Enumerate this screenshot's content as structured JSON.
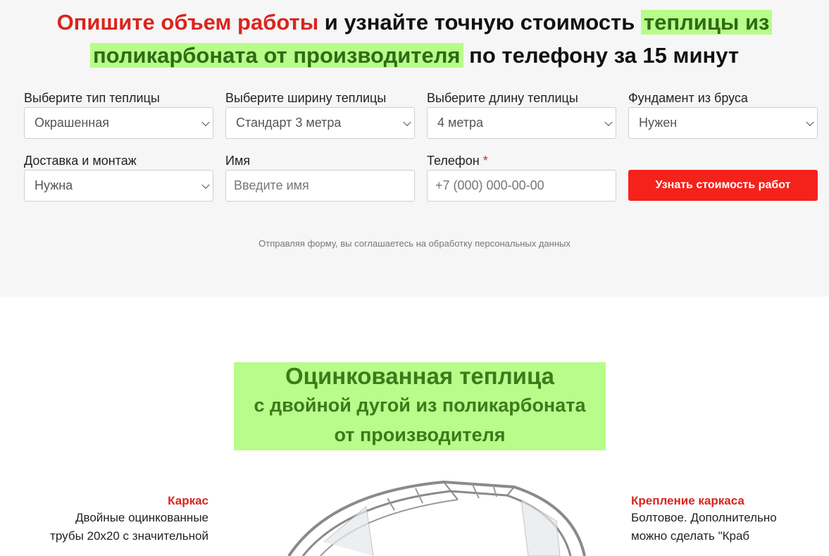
{
  "headline": {
    "part_red": "Опишите объем работы",
    "part_plain1": " и узнайте точную стоимость ",
    "part_green1": "теплицы из",
    "part_green2": "поликарбоната от производителя",
    "part_plain2": " по телефону за 15 минут"
  },
  "form": {
    "type": {
      "label": "Выберите тип теплицы",
      "value": "Окрашенная"
    },
    "width": {
      "label": "Выберите ширину теплицы",
      "value": "Стандарт 3 метра"
    },
    "length": {
      "label": "Выберите длину теплицы",
      "value": "4 метра"
    },
    "foundation": {
      "label": "Фундамент из бруса",
      "value": "Нужен"
    },
    "delivery": {
      "label": "Доставка и монтаж",
      "value": "Нужна"
    },
    "name": {
      "label": "Имя",
      "placeholder": "Введите имя"
    },
    "phone": {
      "label": "Телефон",
      "required_mark": "*",
      "placeholder": "+7 (000) 000-00-00"
    },
    "submit_label": "Узнать стоимость работ",
    "consent": "Отправляя форму, вы соглашаетесь на обработку персональных данных"
  },
  "product": {
    "title_line1": "Оцинкованная теплица",
    "title_line2": "с двойной дугой из поликарбоната",
    "title_line3": "от производителя",
    "left_feature": {
      "title": "Каркас",
      "line1": "Двойные оцинкованные",
      "line2": "трубы 20х20 с значительной"
    },
    "right_feature": {
      "title": "Крепление каркаса",
      "line1": "Болтовое. Дополнительно",
      "line2": "можно сделать \"Краб"
    }
  },
  "colors": {
    "accent_red": "#d9251d",
    "button_red": "#f5221b",
    "highlight_green": "#b8fc8a",
    "green_text": "#3c7a1a"
  }
}
